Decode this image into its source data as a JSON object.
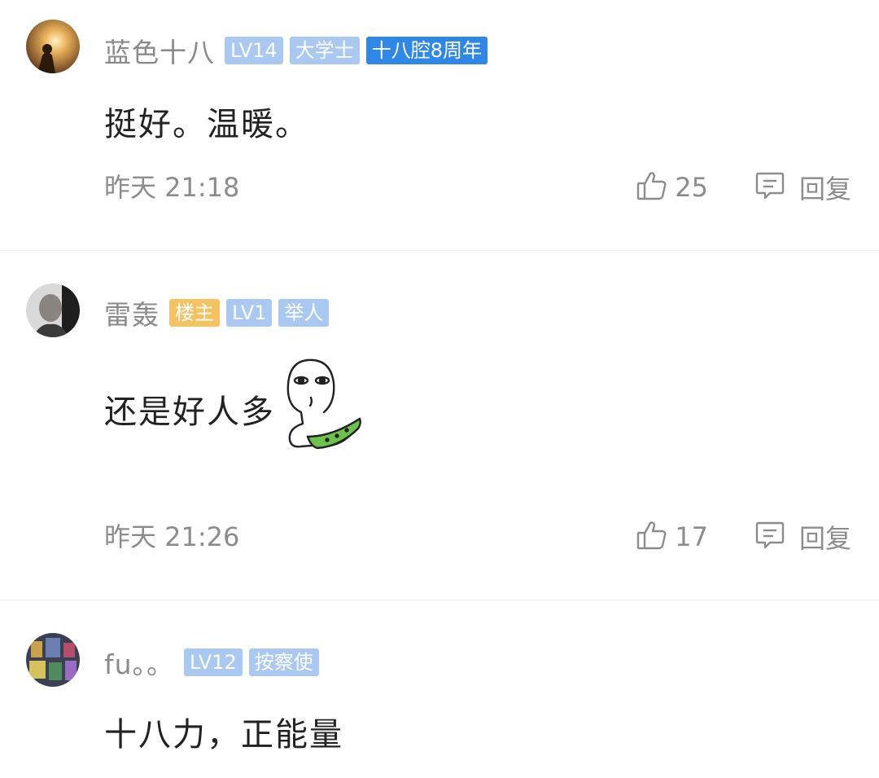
{
  "comments": [
    {
      "username": "蓝色十八",
      "badges": [
        "LV14",
        "大学士",
        "十八腔8周年"
      ],
      "text": "挺好。温暖。",
      "time": "昨天 21:18",
      "likes": "25",
      "reply_label": "回复"
    },
    {
      "username": "雷轰",
      "badges": [
        "楼主",
        "LV1",
        "举人"
      ],
      "text": "还是好人多",
      "time": "昨天 21:26",
      "likes": "17",
      "reply_label": "回复"
    },
    {
      "username": "fu。。",
      "badges": [
        "LV12",
        "按察使"
      ],
      "text": "十八力，正能量"
    }
  ],
  "icons": {
    "like": "thumbs-up-icon",
    "reply": "reply-bubble-icon",
    "sticker": "watermelon-eating-sticker"
  },
  "colors": {
    "badge_light": "#a9c8f2",
    "badge_dark": "#2f87e8",
    "badge_owner": "#f4c260",
    "meta_text": "#8c8c8c"
  }
}
